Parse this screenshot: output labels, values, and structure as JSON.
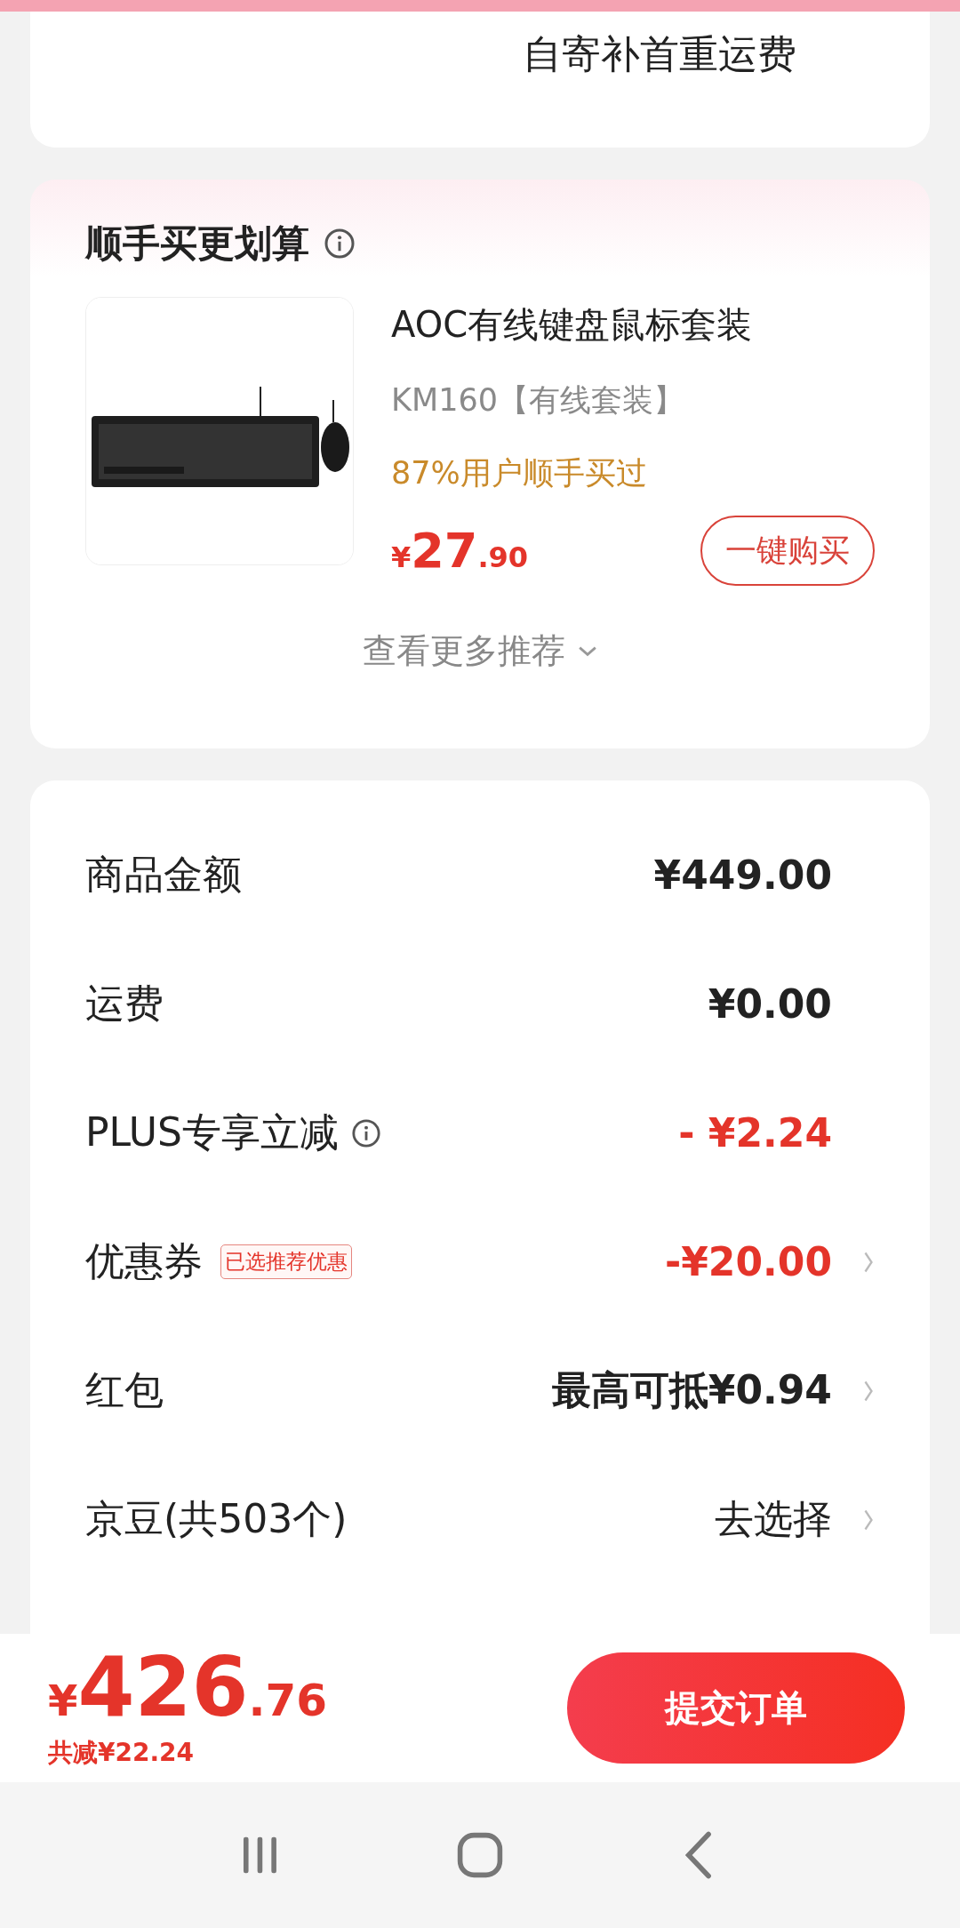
{
  "shipping_note": "自寄补首重运费",
  "bundle": {
    "title": "顺手买更划算",
    "product": {
      "kind": "picture",
      "name": "AOC有线键盘鼠标套装",
      "variant": "KM160【有线套装】",
      "social_proof": "87%用户顺手买过",
      "currency": "¥",
      "price_int": "27",
      "price_dec": ".90",
      "buy_label": "一键购买"
    },
    "more_label": "查看更多推荐"
  },
  "summary": [
    {
      "label": "商品金额",
      "info": false,
      "kind": "amount",
      "value": "¥449.00",
      "arrow": false
    },
    {
      "label": "运费",
      "info": false,
      "kind": "amount",
      "value": "¥0.00",
      "arrow": false
    },
    {
      "label": "PLUS专享立减",
      "info": true,
      "kind": "discount",
      "value": "- ¥2.24",
      "arrow": false
    },
    {
      "label": "优惠券",
      "info": false,
      "tag": "已选推荐优惠",
      "kind": "discount",
      "value": "-¥20.00",
      "arrow": true
    },
    {
      "label": "红包",
      "info": false,
      "kind": "amount",
      "value": "最高可抵¥0.94",
      "arrow": true
    },
    {
      "label": "京豆(共503个)",
      "info": false,
      "kind": "plain",
      "value": "去选择",
      "arrow": true
    }
  ],
  "checkout": {
    "currency": "¥",
    "total_int": "426",
    "total_dec": ".76",
    "saved": "共减¥22.24",
    "submit_label": "提交订单"
  }
}
